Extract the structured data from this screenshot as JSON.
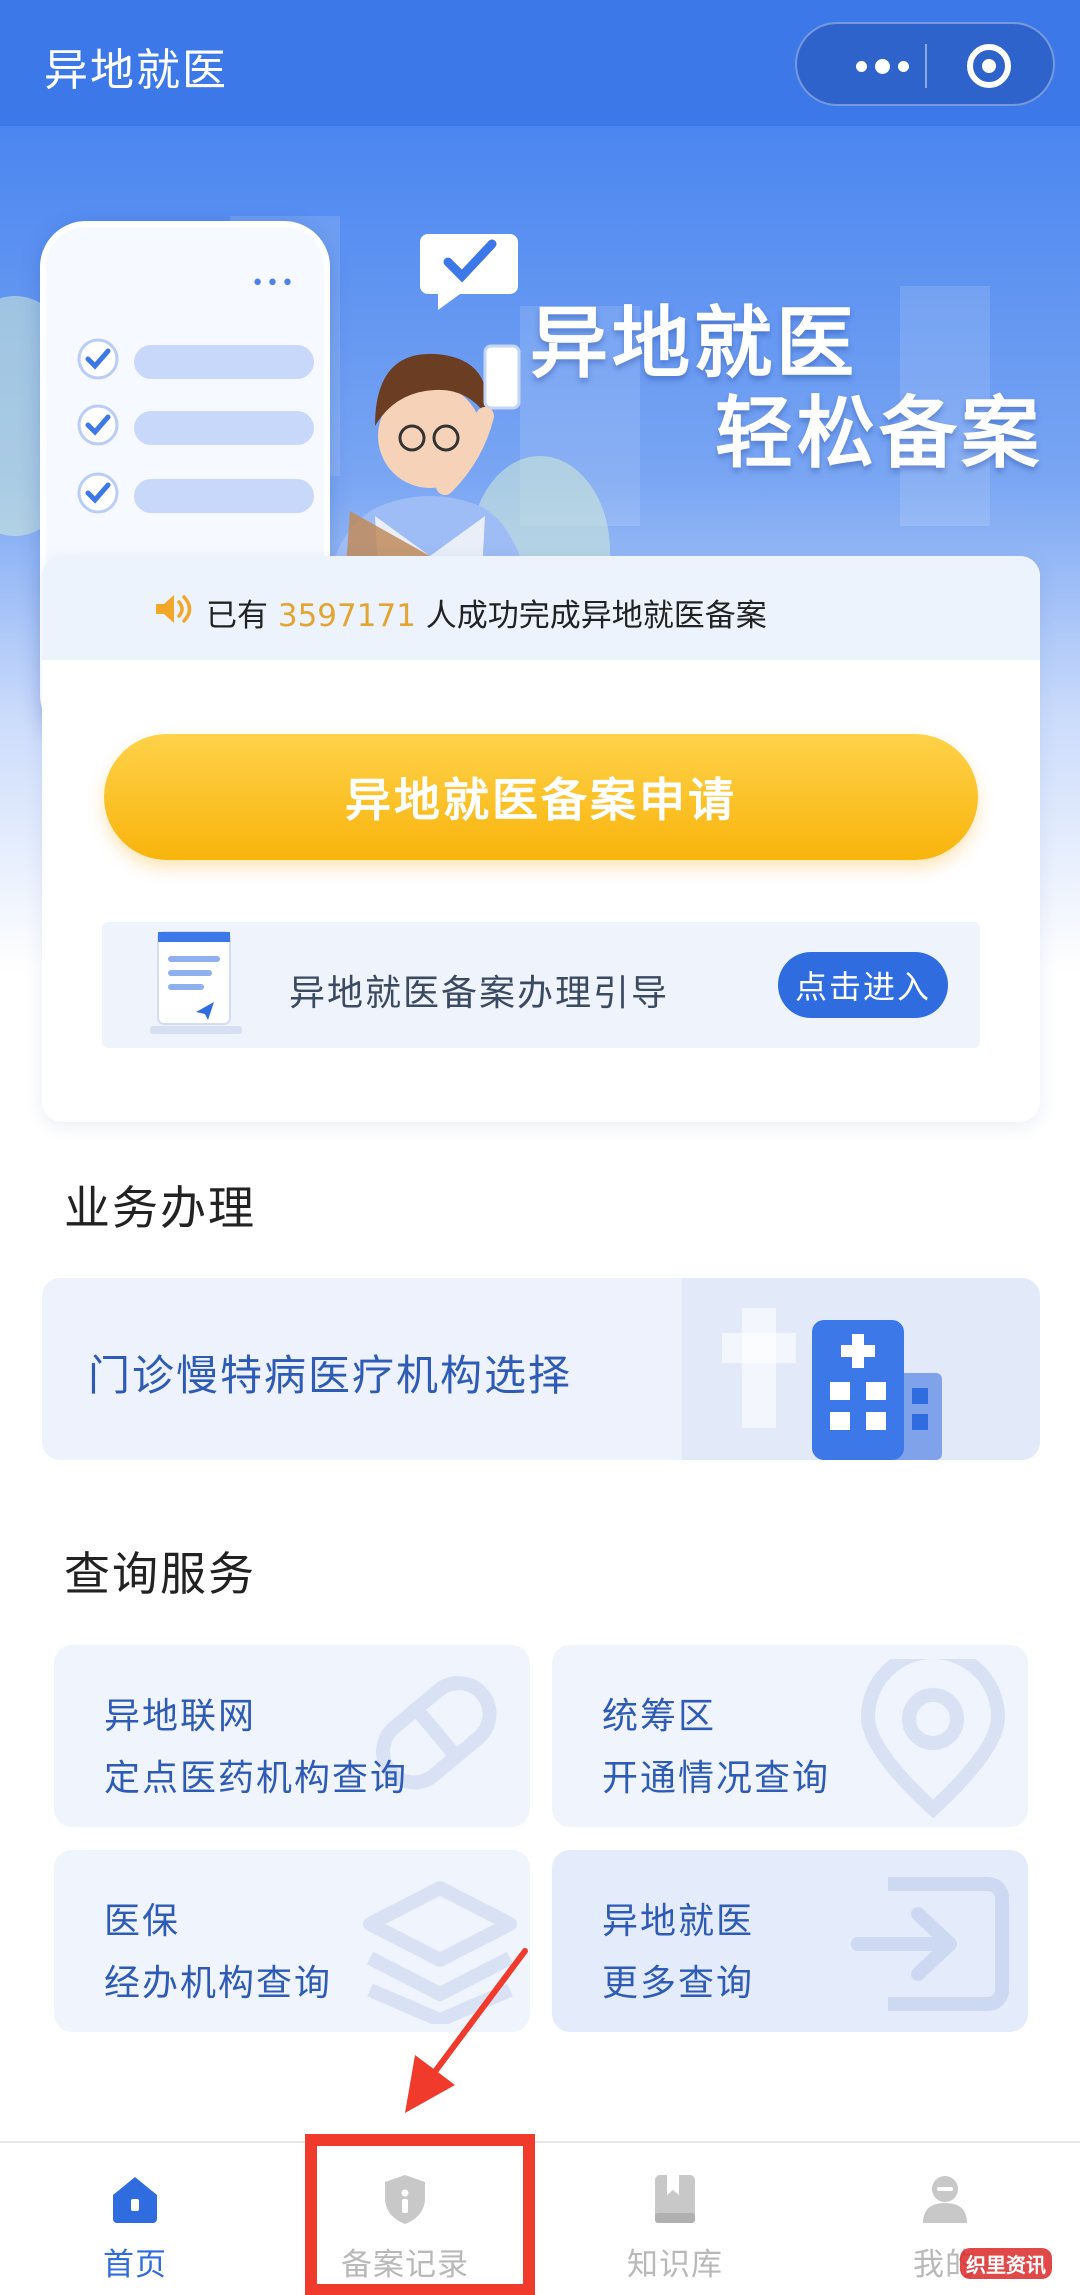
{
  "app": {
    "title": "异地就医"
  },
  "banner": {
    "slogan_line1": "异地就医",
    "slogan_line2": "轻松备案"
  },
  "notice": {
    "prefix": "已有",
    "count": "3597171",
    "suffix": "人成功完成异地就医备案"
  },
  "apply_button": "异地就医备案申请",
  "guide": {
    "text": "异地就医备案办理引导",
    "button": "点击进入"
  },
  "business": {
    "title": "业务办理",
    "clinic_item": "门诊慢特病医疗机构选择"
  },
  "query": {
    "title": "查询服务",
    "cards": [
      {
        "line1": "异地联网",
        "line2": "定点医药机构查询"
      },
      {
        "line1": "统筹区",
        "line2": "开通情况查询"
      },
      {
        "line1": "医保",
        "line2": "经办机构查询"
      },
      {
        "line1": "异地就医",
        "line2": "更多查询"
      }
    ]
  },
  "tabbar": {
    "items": [
      {
        "label": "首页",
        "icon": "home-icon",
        "active": true
      },
      {
        "label": "备案记录",
        "icon": "shield-record-icon",
        "active": false
      },
      {
        "label": "知识库",
        "icon": "book-icon",
        "active": false
      },
      {
        "label": "我的",
        "icon": "user-icon",
        "active": false
      }
    ]
  },
  "watermark": "织里资讯",
  "colors": {
    "primary": "#3d78e8",
    "accent_yellow": "#f8b40c",
    "highlight_number": "#e3a531",
    "annotation_red": "#f03a2c",
    "tab_active": "#2f6ce0",
    "tab_inactive": "#b9b9b9"
  }
}
